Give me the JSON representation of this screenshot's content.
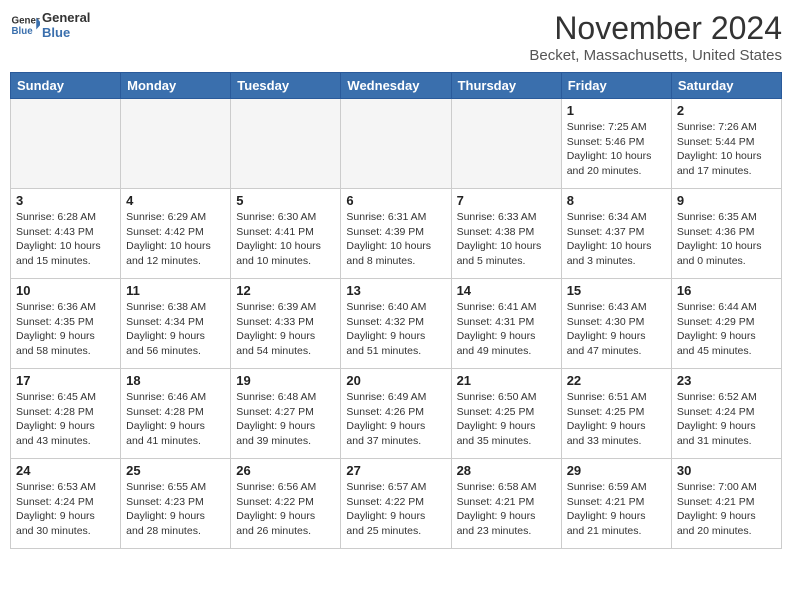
{
  "header": {
    "logo_general": "General",
    "logo_blue": "Blue",
    "month": "November 2024",
    "location": "Becket, Massachusetts, United States"
  },
  "weekdays": [
    "Sunday",
    "Monday",
    "Tuesday",
    "Wednesday",
    "Thursday",
    "Friday",
    "Saturday"
  ],
  "weeks": [
    [
      {
        "day": "",
        "info": ""
      },
      {
        "day": "",
        "info": ""
      },
      {
        "day": "",
        "info": ""
      },
      {
        "day": "",
        "info": ""
      },
      {
        "day": "",
        "info": ""
      },
      {
        "day": "1",
        "info": "Sunrise: 7:25 AM\nSunset: 5:46 PM\nDaylight: 10 hours\nand 20 minutes."
      },
      {
        "day": "2",
        "info": "Sunrise: 7:26 AM\nSunset: 5:44 PM\nDaylight: 10 hours\nand 17 minutes."
      }
    ],
    [
      {
        "day": "3",
        "info": "Sunrise: 6:28 AM\nSunset: 4:43 PM\nDaylight: 10 hours\nand 15 minutes."
      },
      {
        "day": "4",
        "info": "Sunrise: 6:29 AM\nSunset: 4:42 PM\nDaylight: 10 hours\nand 12 minutes."
      },
      {
        "day": "5",
        "info": "Sunrise: 6:30 AM\nSunset: 4:41 PM\nDaylight: 10 hours\nand 10 minutes."
      },
      {
        "day": "6",
        "info": "Sunrise: 6:31 AM\nSunset: 4:39 PM\nDaylight: 10 hours\nand 8 minutes."
      },
      {
        "day": "7",
        "info": "Sunrise: 6:33 AM\nSunset: 4:38 PM\nDaylight: 10 hours\nand 5 minutes."
      },
      {
        "day": "8",
        "info": "Sunrise: 6:34 AM\nSunset: 4:37 PM\nDaylight: 10 hours\nand 3 minutes."
      },
      {
        "day": "9",
        "info": "Sunrise: 6:35 AM\nSunset: 4:36 PM\nDaylight: 10 hours\nand 0 minutes."
      }
    ],
    [
      {
        "day": "10",
        "info": "Sunrise: 6:36 AM\nSunset: 4:35 PM\nDaylight: 9 hours\nand 58 minutes."
      },
      {
        "day": "11",
        "info": "Sunrise: 6:38 AM\nSunset: 4:34 PM\nDaylight: 9 hours\nand 56 minutes."
      },
      {
        "day": "12",
        "info": "Sunrise: 6:39 AM\nSunset: 4:33 PM\nDaylight: 9 hours\nand 54 minutes."
      },
      {
        "day": "13",
        "info": "Sunrise: 6:40 AM\nSunset: 4:32 PM\nDaylight: 9 hours\nand 51 minutes."
      },
      {
        "day": "14",
        "info": "Sunrise: 6:41 AM\nSunset: 4:31 PM\nDaylight: 9 hours\nand 49 minutes."
      },
      {
        "day": "15",
        "info": "Sunrise: 6:43 AM\nSunset: 4:30 PM\nDaylight: 9 hours\nand 47 minutes."
      },
      {
        "day": "16",
        "info": "Sunrise: 6:44 AM\nSunset: 4:29 PM\nDaylight: 9 hours\nand 45 minutes."
      }
    ],
    [
      {
        "day": "17",
        "info": "Sunrise: 6:45 AM\nSunset: 4:28 PM\nDaylight: 9 hours\nand 43 minutes."
      },
      {
        "day": "18",
        "info": "Sunrise: 6:46 AM\nSunset: 4:28 PM\nDaylight: 9 hours\nand 41 minutes."
      },
      {
        "day": "19",
        "info": "Sunrise: 6:48 AM\nSunset: 4:27 PM\nDaylight: 9 hours\nand 39 minutes."
      },
      {
        "day": "20",
        "info": "Sunrise: 6:49 AM\nSunset: 4:26 PM\nDaylight: 9 hours\nand 37 minutes."
      },
      {
        "day": "21",
        "info": "Sunrise: 6:50 AM\nSunset: 4:25 PM\nDaylight: 9 hours\nand 35 minutes."
      },
      {
        "day": "22",
        "info": "Sunrise: 6:51 AM\nSunset: 4:25 PM\nDaylight: 9 hours\nand 33 minutes."
      },
      {
        "day": "23",
        "info": "Sunrise: 6:52 AM\nSunset: 4:24 PM\nDaylight: 9 hours\nand 31 minutes."
      }
    ],
    [
      {
        "day": "24",
        "info": "Sunrise: 6:53 AM\nSunset: 4:24 PM\nDaylight: 9 hours\nand 30 minutes."
      },
      {
        "day": "25",
        "info": "Sunrise: 6:55 AM\nSunset: 4:23 PM\nDaylight: 9 hours\nand 28 minutes."
      },
      {
        "day": "26",
        "info": "Sunrise: 6:56 AM\nSunset: 4:22 PM\nDaylight: 9 hours\nand 26 minutes."
      },
      {
        "day": "27",
        "info": "Sunrise: 6:57 AM\nSunset: 4:22 PM\nDaylight: 9 hours\nand 25 minutes."
      },
      {
        "day": "28",
        "info": "Sunrise: 6:58 AM\nSunset: 4:21 PM\nDaylight: 9 hours\nand 23 minutes."
      },
      {
        "day": "29",
        "info": "Sunrise: 6:59 AM\nSunset: 4:21 PM\nDaylight: 9 hours\nand 21 minutes."
      },
      {
        "day": "30",
        "info": "Sunrise: 7:00 AM\nSunset: 4:21 PM\nDaylight: 9 hours\nand 20 minutes."
      }
    ]
  ]
}
